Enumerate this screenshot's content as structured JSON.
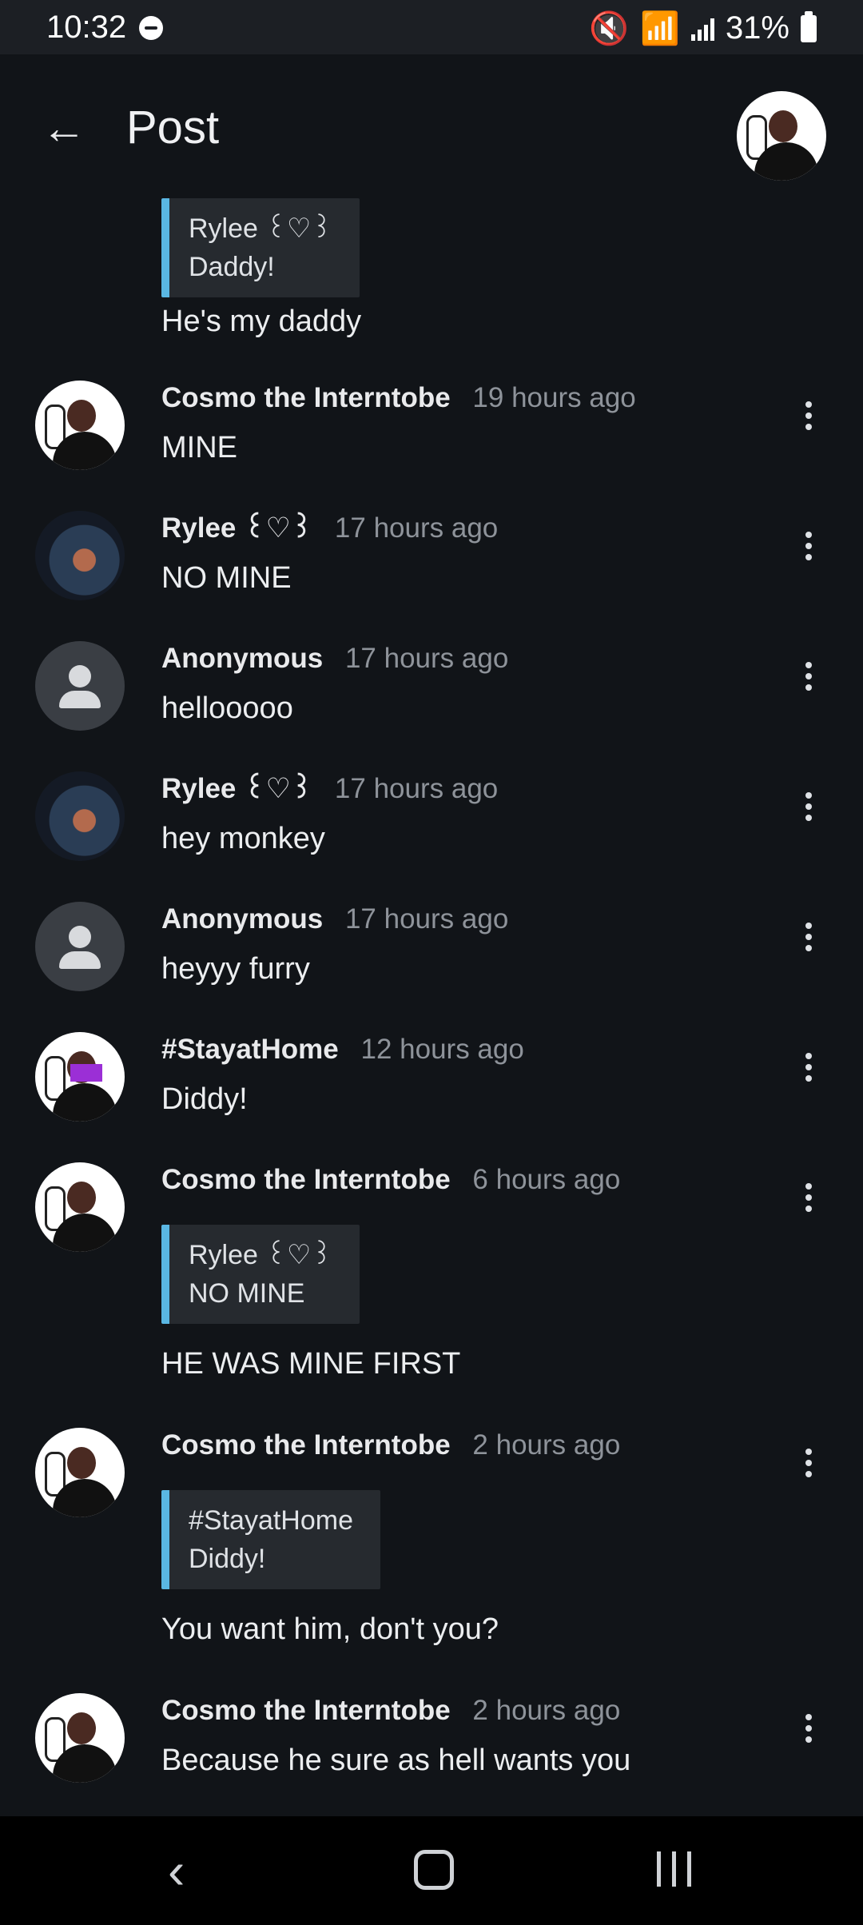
{
  "status_bar": {
    "time": "10:32",
    "battery": "31%"
  },
  "app_bar": {
    "title": "Post"
  },
  "top_partial": {
    "quote_name": "Rylee ꒰♡꒱",
    "quote_text": "Daddy!",
    "body": "He's my daddy"
  },
  "comments": [
    {
      "author": "Cosmo the Interntobe",
      "time": "19 hours ago",
      "text": "MINE"
    },
    {
      "author": "Rylee ꒰♡꒱",
      "time": "17 hours ago",
      "text": "NO MINE"
    },
    {
      "author": "Anonymous",
      "time": "17 hours ago",
      "text": "hellooooo"
    },
    {
      "author": "Rylee ꒰♡꒱",
      "time": "17 hours ago",
      "text": "hey monkey"
    },
    {
      "author": "Anonymous",
      "time": "17 hours ago",
      "text": "heyyy furry"
    },
    {
      "author": "#StayatHome",
      "time": "12 hours ago",
      "text": "Diddy!"
    },
    {
      "author": "Cosmo the Interntobe",
      "time": "6 hours ago",
      "quote_name": "Rylee ꒰♡꒱",
      "quote_text": "NO MINE",
      "text": "HE WAS MINE FIRST"
    },
    {
      "author": "Cosmo the Interntobe",
      "time": "2 hours ago",
      "quote_name": "#StayatHome",
      "quote_text": "Diddy!",
      "text": "You want him, don't you?"
    },
    {
      "author": "Cosmo the Interntobe",
      "time": "2 hours ago",
      "text": "Because he sure as hell wants you"
    }
  ]
}
